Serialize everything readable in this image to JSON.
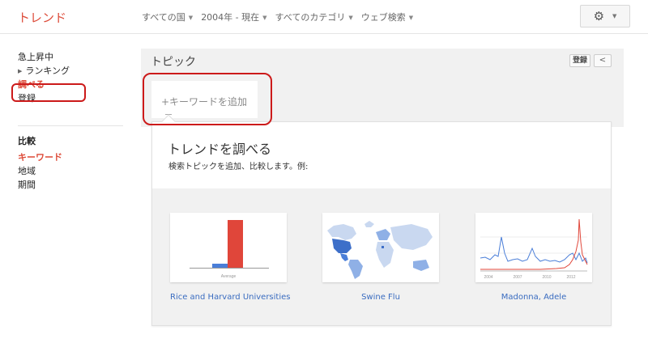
{
  "header": {
    "logo": "トレンド",
    "filters": [
      {
        "label": "すべての国"
      },
      {
        "label": "2004年 - 現在"
      },
      {
        "label": "すべてのカテゴリ"
      },
      {
        "label": "ウェブ検索"
      }
    ],
    "settings_icon": "gear-icon",
    "dropdown_icon": "caret-down-icon"
  },
  "sidebar": {
    "items": [
      {
        "label": "急上昇中"
      },
      {
        "label": "ランキング"
      },
      {
        "label": "調べる",
        "active": true
      },
      {
        "label": "登録"
      }
    ],
    "compare": {
      "heading": "比較",
      "items": [
        {
          "label": "キーワード",
          "active": true
        },
        {
          "label": "地域"
        },
        {
          "label": "期間"
        }
      ]
    }
  },
  "topic": {
    "title": "トピック",
    "register_label": "登録",
    "share_icon": "share-icon",
    "keyword_placeholder": "+キーワードを追加"
  },
  "explore": {
    "title": "トレンドを調べる",
    "subtitle": "検索トピックを追加、比較します。例:",
    "examples": [
      {
        "label": "Rice and Harvard Universities",
        "thumb_caption": "Average"
      },
      {
        "label": "Swine Flu"
      },
      {
        "label": "Madonna, Adele",
        "axis_years": [
          "2004",
          "2007",
          "2010",
          "2012"
        ]
      }
    ]
  },
  "colors": {
    "accent": "#dd4b39",
    "link": "#3a6cc0",
    "highlight_box": "#cc1a1a",
    "series_blue": "#4a7ed8",
    "series_red": "#e0463a"
  }
}
